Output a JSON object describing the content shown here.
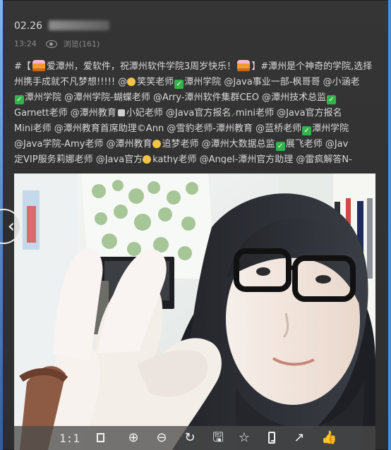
{
  "header": {
    "date": "02.26",
    "time": "13:24",
    "views": "浏览(161)"
  },
  "post": {
    "lines": [
      {
        "segments": [
          {
            "t": "text",
            "v": "#【"
          },
          {
            "t": "cake"
          },
          {
            "t": "text",
            "v": "爱潭州，爱软件，祝潭州软件学院3周岁快乐！"
          },
          {
            "t": "cake"
          },
          {
            "t": "text",
            "v": "】#潭州是个神奇的学院,选择"
          }
        ]
      },
      {
        "segments": [
          {
            "t": "text",
            "v": "州携手成就不凡梦想!!!!! @"
          },
          {
            "t": "smile"
          },
          {
            "t": "text",
            "v": "笑笑老师"
          },
          {
            "t": "check"
          },
          {
            "t": "text",
            "v": "潭州学院  @Java事业一部-枫哥哥  @小涵老"
          }
        ]
      },
      {
        "segments": [
          {
            "t": "check"
          },
          {
            "t": "text",
            "v": "潭州学院  @潭州学院-蝴蝶老师  @Arry-潭州软件集群CEO  @潭州技术总监"
          },
          {
            "t": "check"
          }
        ]
      },
      {
        "segments": [
          {
            "t": "text",
            "v": "Garnett老师  @潭州教育"
          },
          {
            "t": "mini"
          },
          {
            "t": "text",
            "v": "小妃老师  @Java官方报名"
          },
          {
            "t": "leaf"
          },
          {
            "t": "text",
            "v": "mini老师  @Java官方报名"
          }
        ]
      },
      {
        "segments": [
          {
            "t": "text",
            "v": "Mini老师  @潭州教育首席助理©Ann  @雪豹老师-潭州教育  @蓝桥老师"
          },
          {
            "t": "check"
          },
          {
            "t": "text",
            "v": "潭州学院"
          }
        ]
      },
      {
        "segments": [
          {
            "t": "text",
            "v": " @Java学院-Amy老师  @潭州教育"
          },
          {
            "t": "smile"
          },
          {
            "t": "text",
            "v": "追梦老师  @潭州大数据总监"
          },
          {
            "t": "check"
          },
          {
            "t": "text",
            "v": "展飞老师  @Jav"
          }
        ]
      },
      {
        "segments": [
          {
            "t": "text",
            "v": "定VIP服务莉娜老师  @Java官方"
          },
          {
            "t": "smile"
          },
          {
            "t": "text",
            "v": "kathy老师  @Angel-潭州官方助理  @雷疯解答N-"
          }
        ]
      }
    ]
  },
  "toolbar": {
    "zoom_label": "1:1",
    "buttons": [
      {
        "name": "fit-screen-icon",
        "glyph": "▭"
      },
      {
        "name": "zoom-in-icon",
        "glyph": "⊕"
      },
      {
        "name": "zoom-out-icon",
        "glyph": "⊖"
      },
      {
        "name": "rotate-icon",
        "glyph": "↻"
      },
      {
        "name": "save-icon",
        "glyph": "🖫"
      },
      {
        "name": "favorite-icon",
        "glyph": "☆"
      },
      {
        "name": "phone-icon",
        "glyph": ""
      },
      {
        "name": "share-icon",
        "glyph": "↗"
      },
      {
        "name": "like-icon",
        "glyph": "👍"
      }
    ]
  },
  "navigation": {
    "prev_icon": "‹"
  },
  "colors": {
    "background": "#2f2f2f",
    "text": "#d9d9d9",
    "accent_green": "#34b34a",
    "edge_blue": "#4b90d6"
  }
}
